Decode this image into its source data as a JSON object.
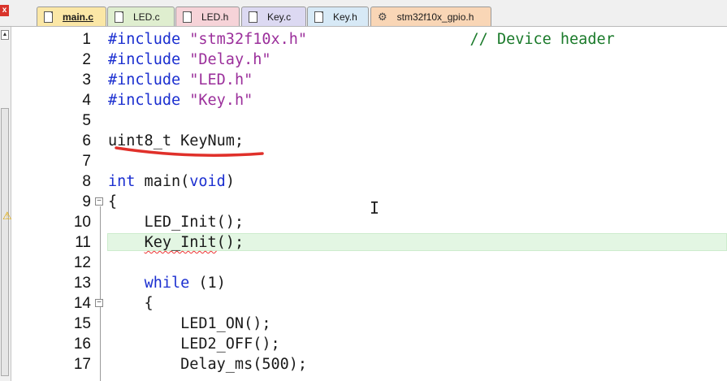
{
  "tabs": [
    {
      "label": "main.c",
      "icon": "file-icon",
      "color": "#fbe7a6",
      "active": true
    },
    {
      "label": "LED.c",
      "icon": "file-icon",
      "color": "#dfeecf",
      "active": false
    },
    {
      "label": "LED.h",
      "icon": "file-icon",
      "color": "#f6d3d8",
      "active": false
    },
    {
      "label": "Key.c",
      "icon": "file-icon",
      "color": "#dcd9f2",
      "active": false
    },
    {
      "label": "Key.h",
      "icon": "file-icon",
      "color": "#d7e9f6",
      "active": false
    },
    {
      "label": "stm32f10x_gpio.h",
      "icon": "settings-file-icon",
      "color": "#f9d6b6",
      "active": false
    }
  ],
  "close_symbol": "x",
  "editor": {
    "highlighted_line": 11,
    "warning_line": 11,
    "lines": [
      {
        "n": "1",
        "code": "#include \"stm32f10x.h\"                  // Device header"
      },
      {
        "n": "2",
        "code": "#include \"Delay.h\""
      },
      {
        "n": "3",
        "code": "#include \"LED.h\""
      },
      {
        "n": "4",
        "code": "#include \"Key.h\""
      },
      {
        "n": "5",
        "code": ""
      },
      {
        "n": "6",
        "code": "uint8_t KeyNum;"
      },
      {
        "n": "7",
        "code": ""
      },
      {
        "n": "8",
        "code": "int main(void)"
      },
      {
        "n": "9",
        "code": "{"
      },
      {
        "n": "10",
        "code": "    LED_Init();"
      },
      {
        "n": "11",
        "code": "    Key_Init();"
      },
      {
        "n": "12",
        "code": ""
      },
      {
        "n": "13",
        "code": "    while (1)"
      },
      {
        "n": "14",
        "code": "    {"
      },
      {
        "n": "15",
        "code": "        LED1_ON();"
      },
      {
        "n": "16",
        "code": "        LED2_OFF();"
      },
      {
        "n": "17",
        "code": "        Delay_ms(500);"
      }
    ]
  },
  "colors": {
    "keyword": "#1b2fd0",
    "string": "#9b2f9b",
    "comment": "#1a7a2a",
    "annotation": "#e0302a",
    "current_line": "#e3f6e3"
  }
}
